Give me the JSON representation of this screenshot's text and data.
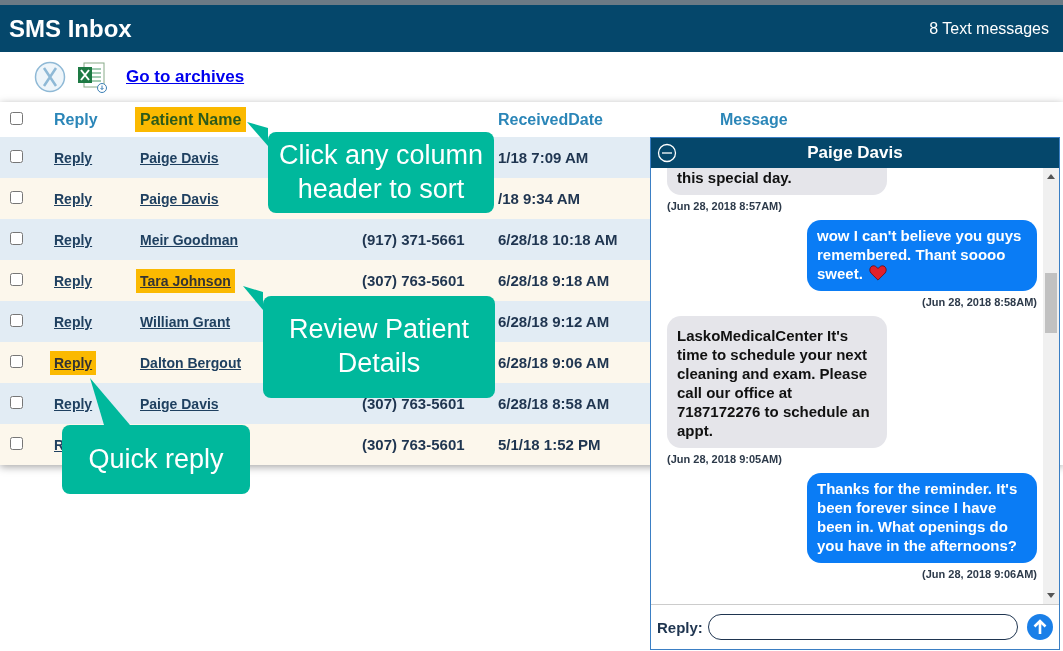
{
  "header": {
    "title": "SMS Inbox",
    "count": "8 Text messages"
  },
  "toolbar": {
    "archive_link": "Go to archives"
  },
  "table": {
    "select_all_checked": false,
    "columns": [
      {
        "label": "Reply",
        "highlighted": false
      },
      {
        "label": "Patient Name",
        "highlighted": true
      },
      {
        "label": "ReceivedDate",
        "highlighted": false
      },
      {
        "label": "Message",
        "highlighted": false
      }
    ],
    "rows": [
      {
        "checked": false,
        "reply": "Reply",
        "reply_highlighted": false,
        "name": "Paige Davis",
        "name_highlighted": false,
        "date": "1/18 7:09 AM"
      },
      {
        "checked": false,
        "reply": "Reply",
        "reply_highlighted": false,
        "name": "Paige Davis",
        "name_highlighted": false,
        "date": "/18 9:34 AM"
      },
      {
        "checked": false,
        "reply": "Reply",
        "reply_highlighted": false,
        "name": "Meir Goodman",
        "name_highlighted": false,
        "number": "(917) 371-5661",
        "date": "6/28/18 10:18 AM"
      },
      {
        "checked": false,
        "reply": "Reply",
        "reply_highlighted": false,
        "name": "Tara Johnson",
        "name_highlighted": true,
        "number": "(307) 763-5601",
        "date": "6/28/18 9:18 AM"
      },
      {
        "checked": false,
        "reply": "Reply",
        "reply_highlighted": false,
        "name": "William Grant",
        "name_highlighted": false,
        "date": "6/28/18 9:12 AM"
      },
      {
        "checked": false,
        "reply": "Reply",
        "reply_highlighted": true,
        "name": "Dalton Bergout",
        "name_highlighted": false,
        "date": "6/28/18 9:06 AM"
      },
      {
        "checked": false,
        "reply": "Reply",
        "reply_highlighted": false,
        "name": "Paige Davis",
        "name_highlighted": false,
        "number": "(307) 763-5601",
        "date": "6/28/18 8:58 AM"
      },
      {
        "checked": false,
        "reply": "R",
        "reply_highlighted": false,
        "number": "(307) 763-5601",
        "date": "5/1/18 1:52 PM"
      }
    ]
  },
  "chat": {
    "title": "Paige Davis",
    "messages": [
      {
        "kind": "incoming",
        "text": "this special day.",
        "time": "(Jun 28, 2018 8:57AM)"
      },
      {
        "kind": "outgoing",
        "text": "wow I can't believe you guys remembered. Thant soooo sweet.",
        "heart": true,
        "time": "(Jun 28, 2018 8:58AM)"
      },
      {
        "kind": "incoming",
        "text": "LaskoMedicalCenter It's time to schedule your next cleaning and exam. Please call our office at 7187172276 to schedule an appt.",
        "time": "(Jun 28, 2018 9:05AM)"
      },
      {
        "kind": "outgoing",
        "text": "Thanks for the reminder. It's been forever since I have been in. What openings do you have in the afternoons?",
        "time": "(Jun 28, 2018 9:06AM)"
      }
    ],
    "reply_label": "Reply:"
  },
  "callouts": [
    {
      "text": "Click any column header to sort"
    },
    {
      "text": "Review Patient Details"
    },
    {
      "text": "Quick reply"
    }
  ]
}
